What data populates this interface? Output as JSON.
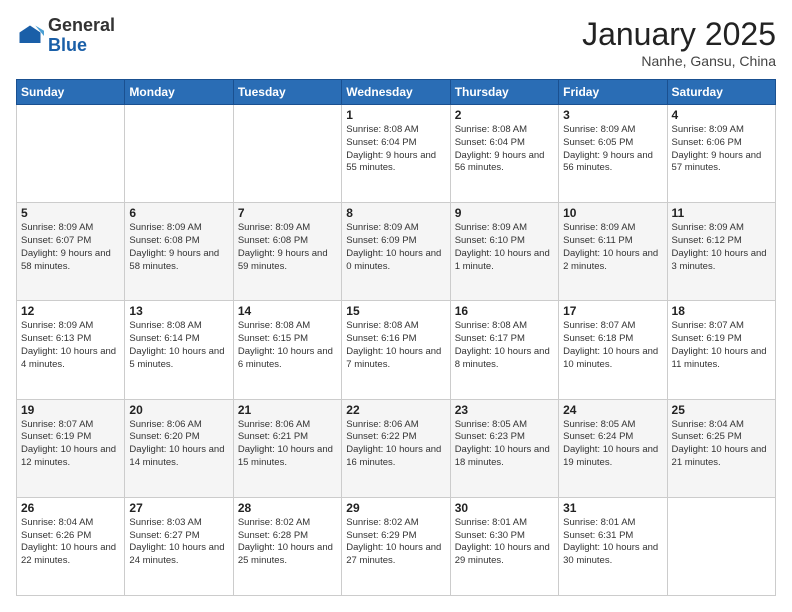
{
  "header": {
    "logo_general": "General",
    "logo_blue": "Blue",
    "month_title": "January 2025",
    "location": "Nanhe, Gansu, China"
  },
  "days_of_week": [
    "Sunday",
    "Monday",
    "Tuesday",
    "Wednesday",
    "Thursday",
    "Friday",
    "Saturday"
  ],
  "weeks": [
    [
      {
        "day": "",
        "info": ""
      },
      {
        "day": "",
        "info": ""
      },
      {
        "day": "",
        "info": ""
      },
      {
        "day": "1",
        "info": "Sunrise: 8:08 AM\nSunset: 6:04 PM\nDaylight: 9 hours\nand 55 minutes."
      },
      {
        "day": "2",
        "info": "Sunrise: 8:08 AM\nSunset: 6:04 PM\nDaylight: 9 hours\nand 56 minutes."
      },
      {
        "day": "3",
        "info": "Sunrise: 8:09 AM\nSunset: 6:05 PM\nDaylight: 9 hours\nand 56 minutes."
      },
      {
        "day": "4",
        "info": "Sunrise: 8:09 AM\nSunset: 6:06 PM\nDaylight: 9 hours\nand 57 minutes."
      }
    ],
    [
      {
        "day": "5",
        "info": "Sunrise: 8:09 AM\nSunset: 6:07 PM\nDaylight: 9 hours\nand 58 minutes."
      },
      {
        "day": "6",
        "info": "Sunrise: 8:09 AM\nSunset: 6:08 PM\nDaylight: 9 hours\nand 58 minutes."
      },
      {
        "day": "7",
        "info": "Sunrise: 8:09 AM\nSunset: 6:08 PM\nDaylight: 9 hours\nand 59 minutes."
      },
      {
        "day": "8",
        "info": "Sunrise: 8:09 AM\nSunset: 6:09 PM\nDaylight: 10 hours\nand 0 minutes."
      },
      {
        "day": "9",
        "info": "Sunrise: 8:09 AM\nSunset: 6:10 PM\nDaylight: 10 hours\nand 1 minute."
      },
      {
        "day": "10",
        "info": "Sunrise: 8:09 AM\nSunset: 6:11 PM\nDaylight: 10 hours\nand 2 minutes."
      },
      {
        "day": "11",
        "info": "Sunrise: 8:09 AM\nSunset: 6:12 PM\nDaylight: 10 hours\nand 3 minutes."
      }
    ],
    [
      {
        "day": "12",
        "info": "Sunrise: 8:09 AM\nSunset: 6:13 PM\nDaylight: 10 hours\nand 4 minutes."
      },
      {
        "day": "13",
        "info": "Sunrise: 8:08 AM\nSunset: 6:14 PM\nDaylight: 10 hours\nand 5 minutes."
      },
      {
        "day": "14",
        "info": "Sunrise: 8:08 AM\nSunset: 6:15 PM\nDaylight: 10 hours\nand 6 minutes."
      },
      {
        "day": "15",
        "info": "Sunrise: 8:08 AM\nSunset: 6:16 PM\nDaylight: 10 hours\nand 7 minutes."
      },
      {
        "day": "16",
        "info": "Sunrise: 8:08 AM\nSunset: 6:17 PM\nDaylight: 10 hours\nand 8 minutes."
      },
      {
        "day": "17",
        "info": "Sunrise: 8:07 AM\nSunset: 6:18 PM\nDaylight: 10 hours\nand 10 minutes."
      },
      {
        "day": "18",
        "info": "Sunrise: 8:07 AM\nSunset: 6:19 PM\nDaylight: 10 hours\nand 11 minutes."
      }
    ],
    [
      {
        "day": "19",
        "info": "Sunrise: 8:07 AM\nSunset: 6:19 PM\nDaylight: 10 hours\nand 12 minutes."
      },
      {
        "day": "20",
        "info": "Sunrise: 8:06 AM\nSunset: 6:20 PM\nDaylight: 10 hours\nand 14 minutes."
      },
      {
        "day": "21",
        "info": "Sunrise: 8:06 AM\nSunset: 6:21 PM\nDaylight: 10 hours\nand 15 minutes."
      },
      {
        "day": "22",
        "info": "Sunrise: 8:06 AM\nSunset: 6:22 PM\nDaylight: 10 hours\nand 16 minutes."
      },
      {
        "day": "23",
        "info": "Sunrise: 8:05 AM\nSunset: 6:23 PM\nDaylight: 10 hours\nand 18 minutes."
      },
      {
        "day": "24",
        "info": "Sunrise: 8:05 AM\nSunset: 6:24 PM\nDaylight: 10 hours\nand 19 minutes."
      },
      {
        "day": "25",
        "info": "Sunrise: 8:04 AM\nSunset: 6:25 PM\nDaylight: 10 hours\nand 21 minutes."
      }
    ],
    [
      {
        "day": "26",
        "info": "Sunrise: 8:04 AM\nSunset: 6:26 PM\nDaylight: 10 hours\nand 22 minutes."
      },
      {
        "day": "27",
        "info": "Sunrise: 8:03 AM\nSunset: 6:27 PM\nDaylight: 10 hours\nand 24 minutes."
      },
      {
        "day": "28",
        "info": "Sunrise: 8:02 AM\nSunset: 6:28 PM\nDaylight: 10 hours\nand 25 minutes."
      },
      {
        "day": "29",
        "info": "Sunrise: 8:02 AM\nSunset: 6:29 PM\nDaylight: 10 hours\nand 27 minutes."
      },
      {
        "day": "30",
        "info": "Sunrise: 8:01 AM\nSunset: 6:30 PM\nDaylight: 10 hours\nand 29 minutes."
      },
      {
        "day": "31",
        "info": "Sunrise: 8:01 AM\nSunset: 6:31 PM\nDaylight: 10 hours\nand 30 minutes."
      },
      {
        "day": "",
        "info": ""
      }
    ]
  ]
}
